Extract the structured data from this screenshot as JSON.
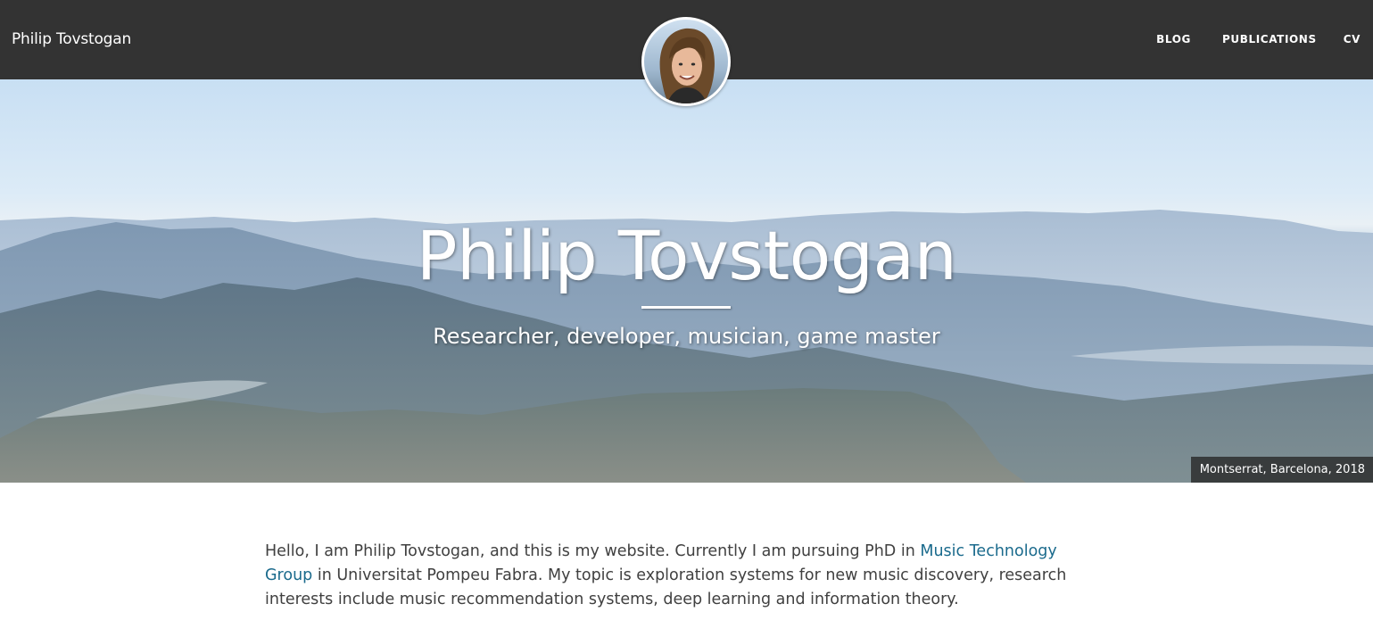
{
  "nav": {
    "brand": "Philip Tovstogan",
    "links": [
      {
        "label": "BLOG"
      },
      {
        "label": "PUBLICATIONS"
      },
      {
        "label": "CV"
      }
    ]
  },
  "hero": {
    "title": "Philip Tovstogan",
    "subtitle": "Researcher, developer, musician, game master",
    "caption": "Montserrat, Barcelona, 2018"
  },
  "intro": {
    "part1": "Hello, I am Philip Tovstogan, and this is my website. Currently I am pursuing PhD in ",
    "link_label": "Music Technology Group",
    "part2": " in Universitat Pompeu Fabra. My topic is exploration systems for new music discovery, research interests include music recommendation systems, deep learning and information theory."
  },
  "colors": {
    "navbar_bg": "#333333",
    "link": "#1a6a8c",
    "body_text": "#404040"
  }
}
